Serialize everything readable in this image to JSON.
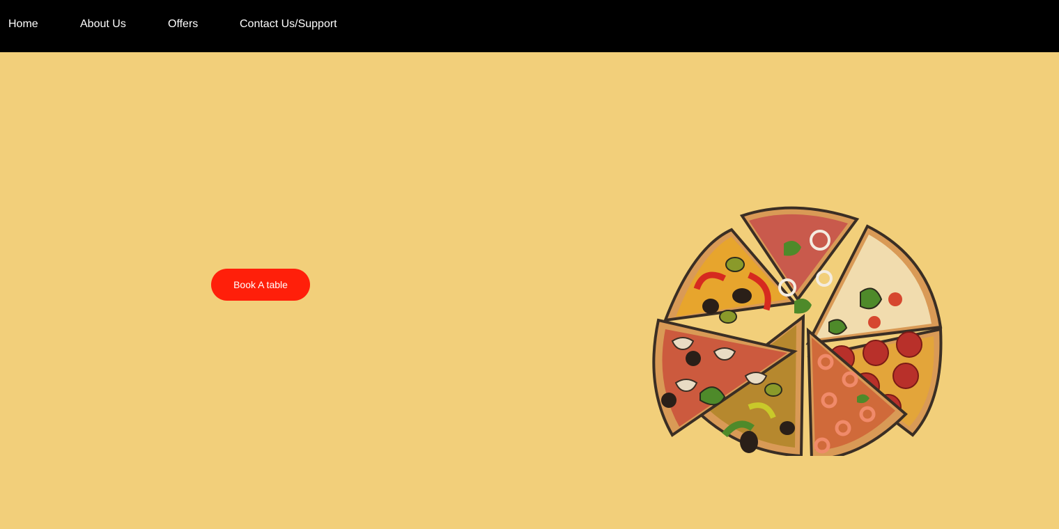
{
  "nav": {
    "items": [
      {
        "label": "Home"
      },
      {
        "label": "About Us"
      },
      {
        "label": "Offers"
      },
      {
        "label": "Contact Us/Support"
      }
    ],
    "background": "#000000",
    "text_color": "#ffffff"
  },
  "hero": {
    "background": "#f2cf7a",
    "cta_label": "Book A table",
    "cta_color": "#ff1f0a",
    "image_icon": "pizza-slices-illustration"
  }
}
